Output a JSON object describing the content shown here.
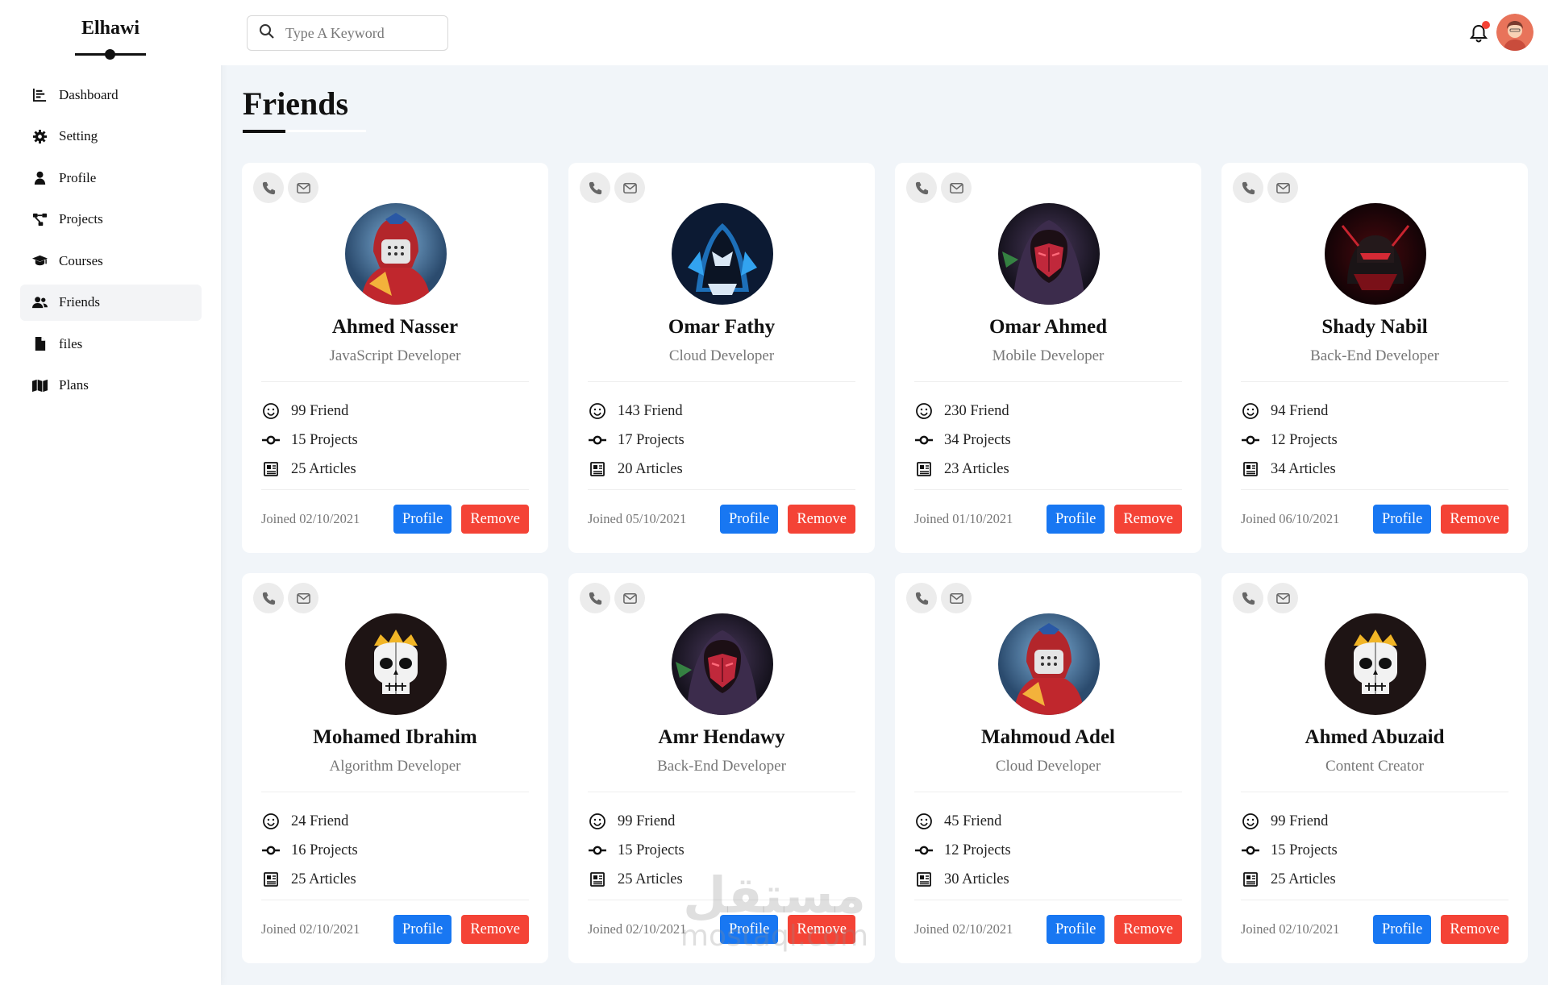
{
  "brand": "Elhawi",
  "sidebar": {
    "items": [
      {
        "label": "Dashboard",
        "icon": "chart-bar-icon"
      },
      {
        "label": "Setting",
        "icon": "gear-icon"
      },
      {
        "label": "Profile",
        "icon": "user-icon"
      },
      {
        "label": "Projects",
        "icon": "diagram-project-icon"
      },
      {
        "label": "Courses",
        "icon": "graduation-cap-icon"
      },
      {
        "label": "Friends",
        "icon": "users-icon",
        "active": true
      },
      {
        "label": "files",
        "icon": "file-icon"
      },
      {
        "label": "Plans",
        "icon": "map-icon"
      }
    ]
  },
  "search": {
    "placeholder": "Type A Keyword",
    "value": ""
  },
  "header": {
    "notification_dot_color": "#f44336"
  },
  "page": {
    "title": "Friends"
  },
  "colors": {
    "primary": "#1877f2",
    "danger": "#f44336",
    "muted": "#777777",
    "background": "#f1f5f9"
  },
  "buttons": {
    "profile": "Profile",
    "remove": "Remove"
  },
  "friends": [
    {
      "name": "Ahmed Nasser",
      "role": "JavaScript Developer",
      "friends": "99 Friend",
      "projects": "15 Projects",
      "articles": "25 Articles",
      "joined": "Joined 02/10/2021",
      "avatar": "red-hooded-gamer-avatar"
    },
    {
      "name": "Omar Fathy",
      "role": "Cloud Developer",
      "friends": "143 Friend",
      "projects": "17 Projects",
      "articles": "20 Articles",
      "joined": "Joined 05/10/2021",
      "avatar": "blue-hooded-mask-avatar"
    },
    {
      "name": "Omar Ahmed",
      "role": "Mobile Developer",
      "friends": "230 Friend",
      "projects": "34 Projects",
      "articles": "23 Articles",
      "joined": "Joined 01/10/2021",
      "avatar": "purple-hood-red-mask-avatar"
    },
    {
      "name": "Shady Nabil",
      "role": "Back-End Developer",
      "friends": "94 Friend",
      "projects": "12 Projects",
      "articles": "34 Articles",
      "joined": "Joined 06/10/2021",
      "avatar": "dark-red-ninja-avatar"
    },
    {
      "name": "Mohamed Ibrahim",
      "role": "Algorithm Developer",
      "friends": "24 Friend",
      "projects": "16 Projects",
      "articles": "25 Articles",
      "joined": "Joined 02/10/2021",
      "avatar": "crowned-skull-avatar"
    },
    {
      "name": "Amr Hendawy",
      "role": "Back-End Developer",
      "friends": "99 Friend",
      "projects": "15 Projects",
      "articles": "25 Articles",
      "joined": "Joined 02/10/2021",
      "avatar": "purple-hood-red-mask-avatar"
    },
    {
      "name": "Mahmoud Adel",
      "role": "Cloud Developer",
      "friends": "45 Friend",
      "projects": "12 Projects",
      "articles": "30 Articles",
      "joined": "Joined 02/10/2021",
      "avatar": "red-hooded-gamer-avatar"
    },
    {
      "name": "Ahmed Abuzaid",
      "role": "Content Creator",
      "friends": "99 Friend",
      "projects": "15 Projects",
      "articles": "25 Articles",
      "joined": "Joined 02/10/2021",
      "avatar": "crowned-skull-avatar"
    }
  ],
  "watermark": {
    "arabic": "مستقل",
    "latin": "mostaql.com"
  }
}
